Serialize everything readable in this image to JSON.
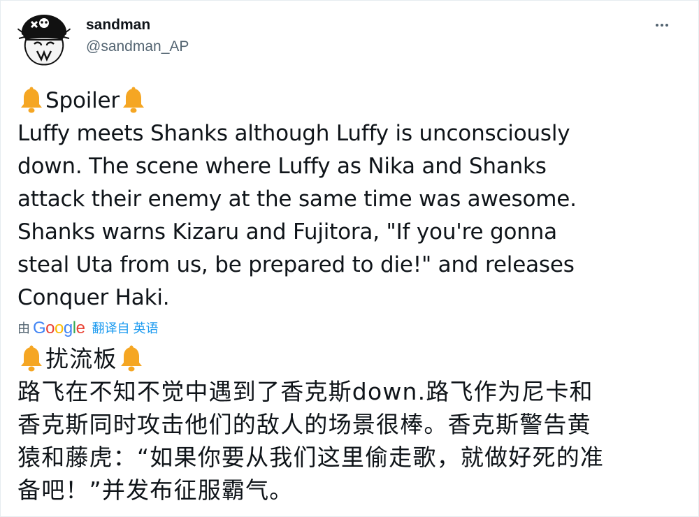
{
  "user": {
    "display_name": "sandman",
    "handle": "@sandman_AP"
  },
  "tweet": {
    "original_title": "Spoiler",
    "original_lines": [
      "Luffy meets Shanks although Luffy is unconsciously",
      "down. The scene where Luffy as Nika and Shanks",
      "attack their enemy at the same time was awesome.",
      "Shanks warns Kizaru and Fujitora, \"If you're gonna",
      "steal Uta from us, be prepared to die!\" and releases",
      "Conquer Haki."
    ],
    "translation_by": "由",
    "translation_provider": "Google",
    "translation_link": "翻译自 英语",
    "translated_title": "扰流板",
    "translated_lines": [
      "路飞在不知不觉中遇到了香克斯down.路飞作为尼卡和",
      "香克斯同时攻击他们的敌人的场景很棒。香克斯警告黄",
      "猿和藤虎：“如果你要从我们这里偷走歌，就做好死的准",
      "备吧！”并发布征服霸气。"
    ]
  },
  "icons": {
    "more": "more-icon",
    "bell": "bell-icon",
    "avatar": "skull-avatar"
  },
  "colors": {
    "bell": "#f5a623",
    "link": "#1d9bf0",
    "muted": "#536471",
    "google_blue": "#4285f4",
    "google_red": "#ea4335",
    "google_yellow": "#fbbc05",
    "google_green": "#34a853"
  }
}
